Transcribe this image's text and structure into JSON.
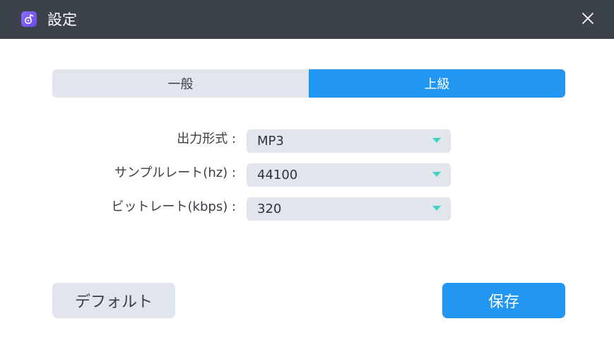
{
  "window": {
    "title": "設定",
    "app_icon": "music-disc-icon",
    "close_icon": "close-icon"
  },
  "tabs": [
    {
      "label": "一般",
      "active": false
    },
    {
      "label": "上級",
      "active": true
    }
  ],
  "settings": {
    "output_format": {
      "label": "出力形式 :",
      "value": "MP3"
    },
    "sample_rate": {
      "label": "サンプルレート(hz) :",
      "value": "44100"
    },
    "bitrate": {
      "label": "ビットレート(kbps) :",
      "value": "320"
    }
  },
  "buttons": {
    "default_label": "デフォルト",
    "save_label": "保存"
  },
  "colors": {
    "titlebar": "#3b424b",
    "accent": "#2196f3",
    "control_bg": "#e1e6ec",
    "dropdown_arrow": "#3fd3c3"
  }
}
